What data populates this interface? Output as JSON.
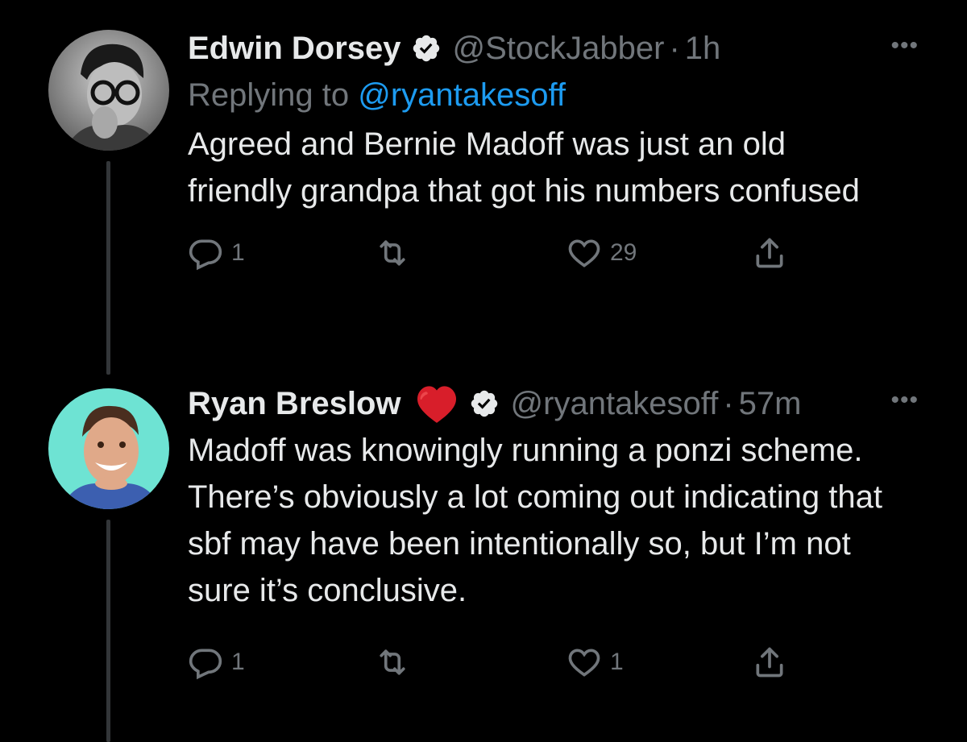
{
  "tweets": [
    {
      "name": "Edwin Dorsey",
      "handle": "@StockJabber",
      "dot": "·",
      "time": "1h",
      "more": "•••",
      "reply_prefix": "Replying to",
      "reply_to": "@ryantakesoff",
      "text": "Agreed and Bernie Madoff was just an old friendly grandpa that got his numbers confused",
      "replies": "1",
      "retweets": "",
      "likes": "29"
    },
    {
      "name": "Ryan Breslow",
      "name_emoji": "heart",
      "handle": "@ryantakesoff",
      "dot": "·",
      "time": "57m",
      "more": "•••",
      "text": "Madoff was knowingly running a ponzi scheme. There’s obviously a lot coming out indicating that sbf may have been intentionally so, but I’m not sure it’s conclusive.",
      "replies": "1",
      "retweets": "",
      "likes": "1"
    }
  ],
  "colors": {
    "background": "#000000",
    "text": "#e7e9ea",
    "muted": "#71767b",
    "link": "#1d9bf0",
    "heart": "#d81e2a"
  },
  "icons": [
    "verified-badge-icon",
    "reply-icon",
    "retweet-icon",
    "like-icon",
    "share-icon",
    "more-icon",
    "heart-emoji-icon"
  ]
}
